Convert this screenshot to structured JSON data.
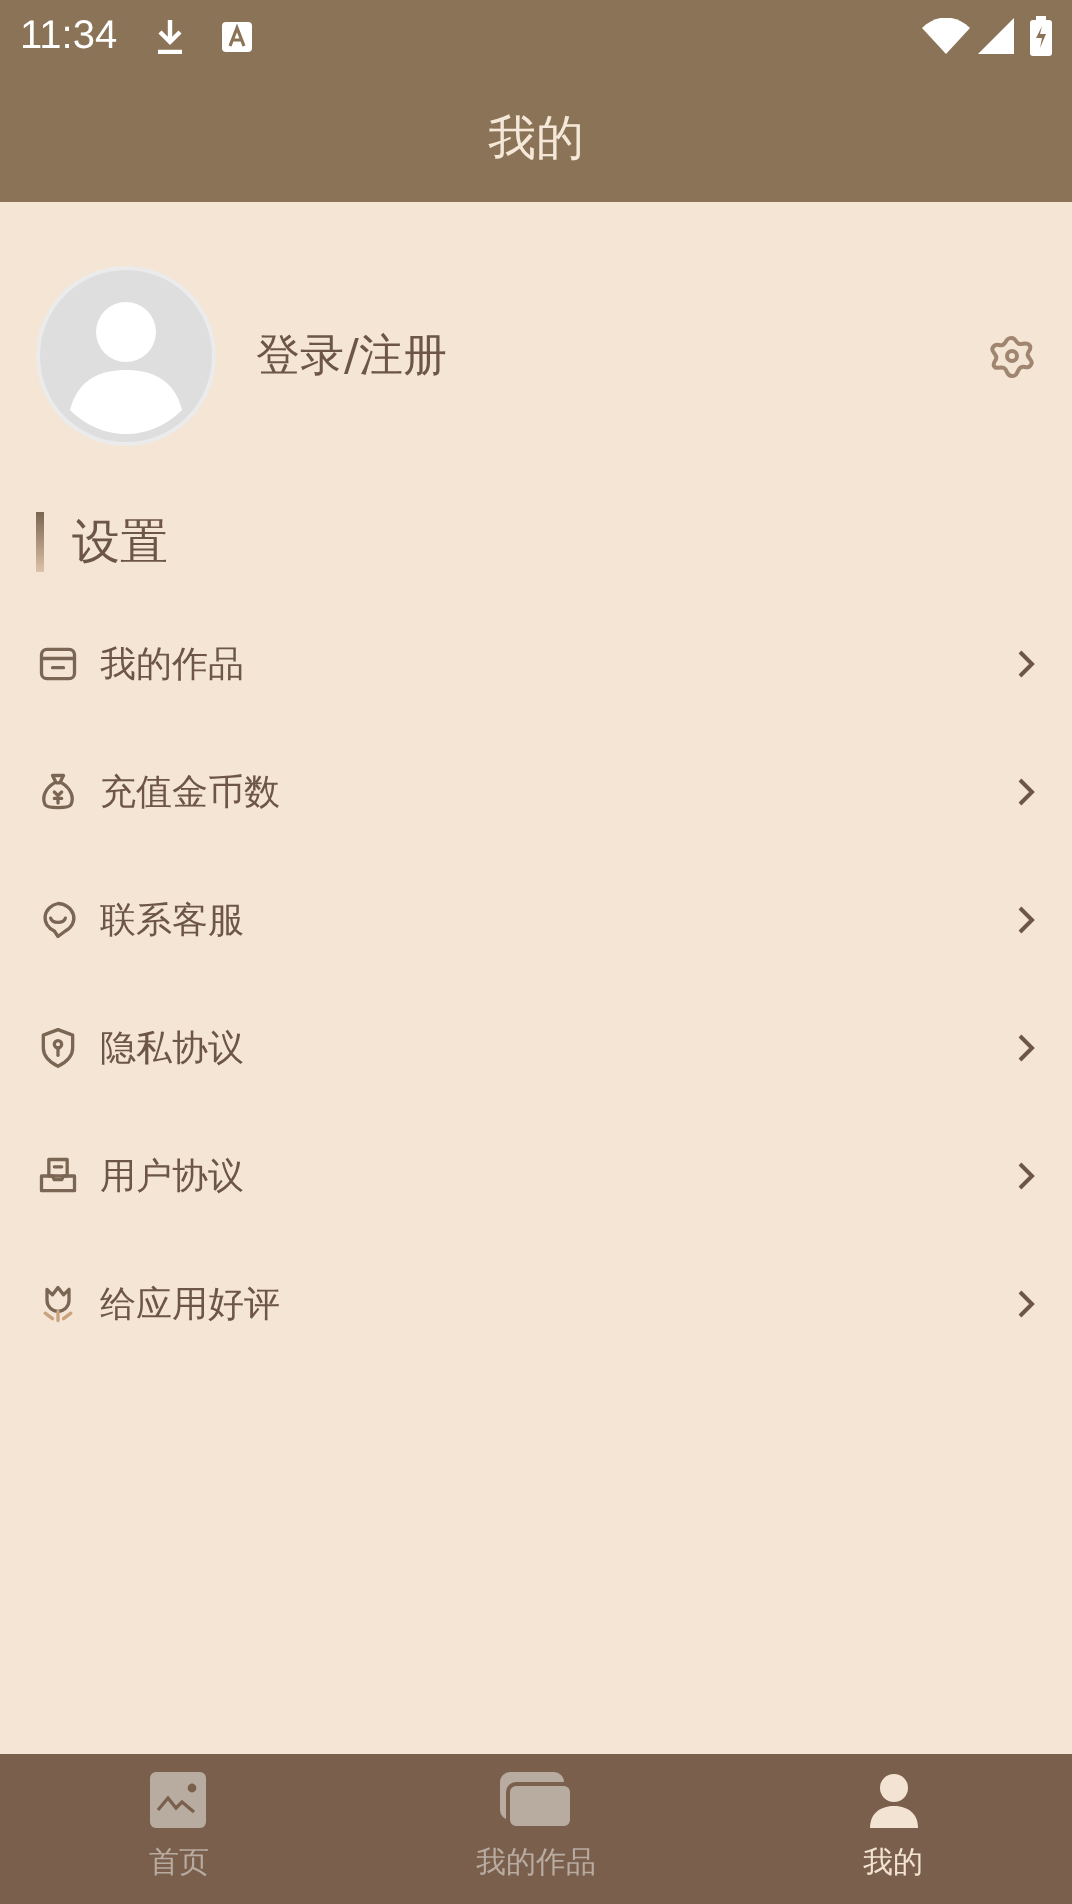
{
  "status_bar": {
    "time": "11:34"
  },
  "header": {
    "title": "我的"
  },
  "profile": {
    "login_label": "登录/注册"
  },
  "section": {
    "title": "设置"
  },
  "menu": [
    {
      "kind": "works",
      "label": "我的作品"
    },
    {
      "kind": "coins",
      "label": "充值金币数"
    },
    {
      "kind": "service",
      "label": "联系客服"
    },
    {
      "kind": "privacy",
      "label": "隐私协议"
    },
    {
      "kind": "agreement",
      "label": "用户协议"
    },
    {
      "kind": "rate",
      "label": "给应用好评"
    }
  ],
  "bottom_nav": [
    {
      "kind": "home",
      "label": "首页",
      "selected": false
    },
    {
      "kind": "works",
      "label": "我的作品",
      "selected": false
    },
    {
      "kind": "me",
      "label": "我的",
      "selected": true
    }
  ]
}
